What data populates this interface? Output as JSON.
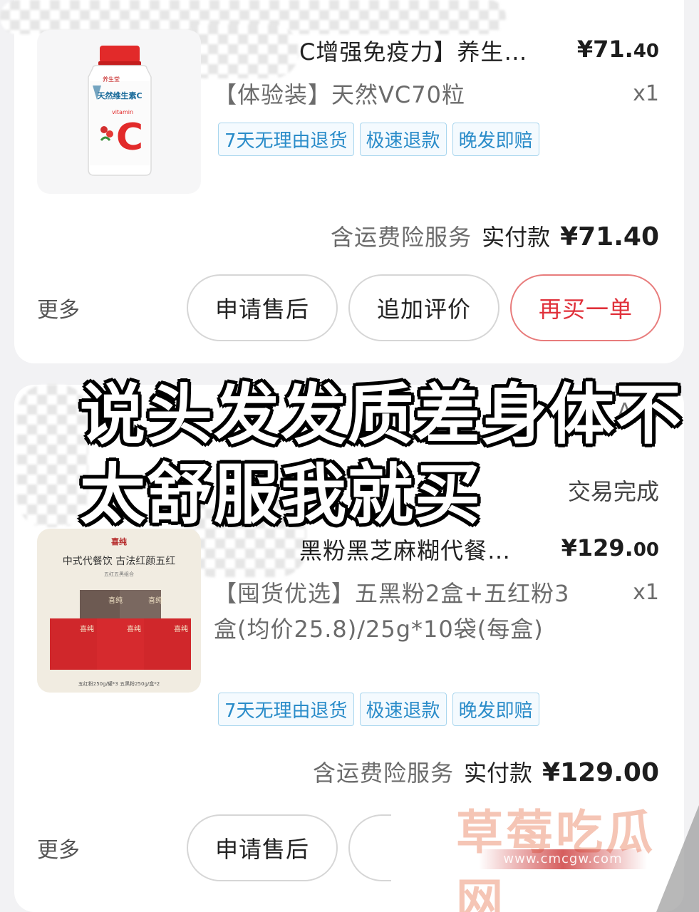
{
  "order1": {
    "title": "C增强免疫力】养生…",
    "price_main": "¥71.",
    "price_cents": "40",
    "sku": "【体验装】天然VC70粒",
    "qty": "x1",
    "tags": [
      "7天无理由退货",
      "极速退款",
      "晚发即赔"
    ],
    "insurance": "含运费险服务",
    "paid_label": "实付款",
    "paid_amount": "¥71.40",
    "more": "更多",
    "buttons": {
      "after_sale": "申请售后",
      "review": "追加评价",
      "rebuy": "再买一单"
    },
    "image": {
      "brand": "养生堂",
      "label": "天然维生素C",
      "sub": "vitamin",
      "letter": "C"
    }
  },
  "order2": {
    "app_label": "App",
    "status": "交易完成",
    "title": "黑粉黑芝麻糊代餐…",
    "price_main": "¥129.",
    "price_cents": "00",
    "sku": "【囤货优选】五黑粉2盒+五红粉3盒(均价25.8)/25g*10袋(每盒)",
    "qty": "x1",
    "tags": [
      "7天无理由退货",
      "极速退款",
      "晚发即赔"
    ],
    "insurance": "含运费险服务",
    "paid_label": "实付款",
    "paid_amount": "¥129.00",
    "more": "更多",
    "buttons": {
      "after_sale": "申请售后"
    },
    "image": {
      "brand": "喜纯",
      "headline": "中式代餐饮 古法红颜五红",
      "sub": "五红五黑组合",
      "box_label": "喜纯",
      "footer": "五红粉250g/罐*3 五黑粉250g/盒*2"
    }
  },
  "overlay": {
    "line1": "说头发发质差身体不",
    "line2": "太舒服我就买"
  },
  "watermark": {
    "text": "草莓吃瓜网",
    "url": "www.cmcgw.com"
  }
}
